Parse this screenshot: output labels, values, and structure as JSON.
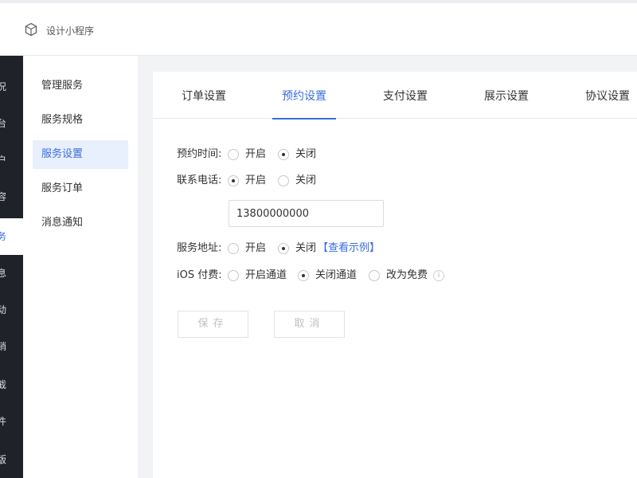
{
  "header": {
    "app_title": "设计小程序",
    "logo_icon": "cube-logo-icon"
  },
  "leftbar": {
    "items": [
      {
        "label": "况",
        "active": false
      },
      {
        "label": "台",
        "active": false
      },
      {
        "label": "户",
        "active": false
      },
      {
        "label": "容",
        "active": false
      },
      {
        "label": "务",
        "active": true
      },
      {
        "label": "息",
        "active": false
      },
      {
        "label": "动",
        "active": false
      },
      {
        "label": "销",
        "active": false
      },
      {
        "label": "截",
        "active": false
      },
      {
        "label": "件",
        "active": false
      },
      {
        "label": "版",
        "active": false
      }
    ]
  },
  "subnav": {
    "items": [
      {
        "label": "管理服务",
        "active": false
      },
      {
        "label": "服务规格",
        "active": false
      },
      {
        "label": "服务设置",
        "active": true
      },
      {
        "label": "服务订单",
        "active": false
      },
      {
        "label": "消息通知",
        "active": false
      }
    ]
  },
  "tabs": [
    {
      "label": "订单设置",
      "active": false
    },
    {
      "label": "预约设置",
      "active": true
    },
    {
      "label": "支付设置",
      "active": false
    },
    {
      "label": "展示设置",
      "active": false
    },
    {
      "label": "协议设置",
      "active": false
    }
  ],
  "form": {
    "booking_time": {
      "label": "预约时间:",
      "option_on": "开启",
      "option_off": "关闭",
      "selected": "off"
    },
    "contact_phone": {
      "label": "联系电话:",
      "option_on": "开启",
      "option_off": "关闭",
      "selected": "on",
      "value": "13800000000"
    },
    "service_address": {
      "label": "服务地址:",
      "option_on": "开启",
      "option_off": "关闭",
      "selected": "off",
      "example_link": "【查看示例】"
    },
    "ios_payment": {
      "label": "iOS 付费:",
      "option_open": "开启通道",
      "option_close": "关闭通道",
      "option_free": "改为免费",
      "selected": "close",
      "info_icon": "info-icon"
    }
  },
  "buttons": {
    "save_label": "保存",
    "cancel_label": "取消"
  },
  "colors": {
    "accent": "#3a6de0",
    "sidebar_dark": "#1f2329",
    "active_bg": "#e8effd"
  }
}
